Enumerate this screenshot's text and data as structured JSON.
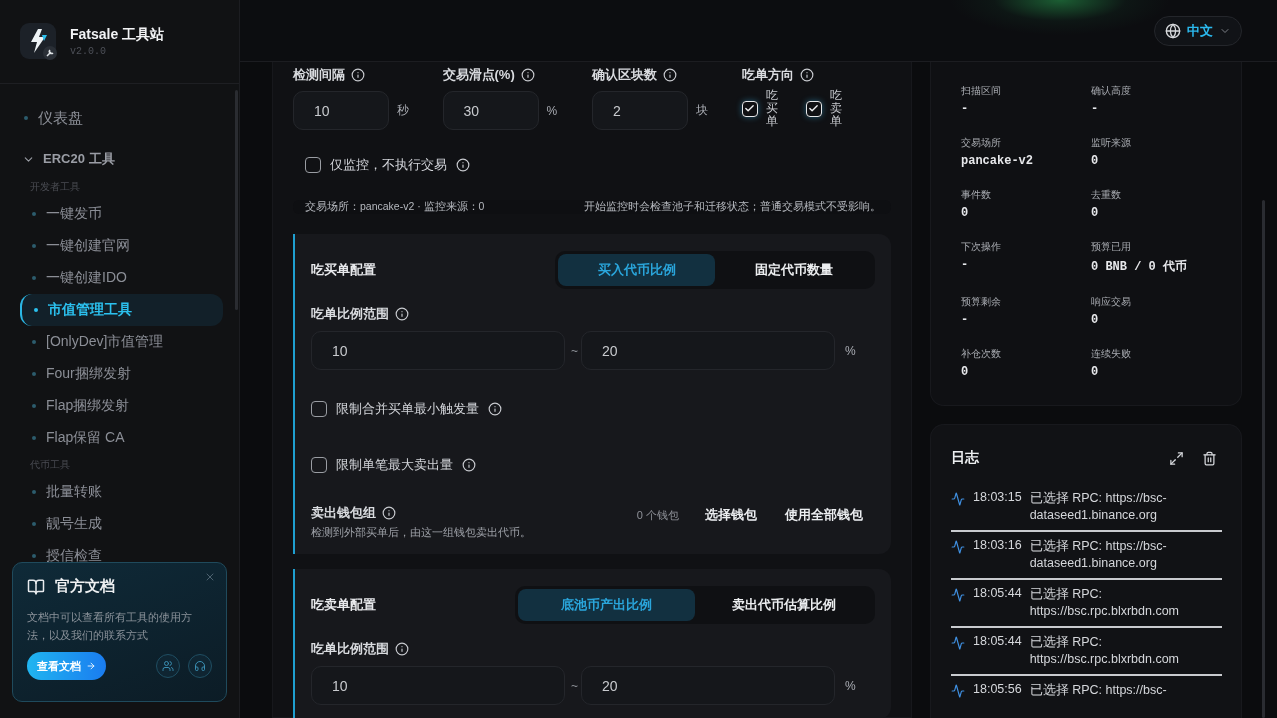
{
  "brand": {
    "title": "Fatsale 工具站",
    "version": "v2.0.0"
  },
  "nav": [
    {
      "kind": "item",
      "label": "仪表盘",
      "selected": false
    },
    {
      "kind": "group",
      "label": "ERC20 工具",
      "expanded": true,
      "sections": [
        {
          "title": "开发者工具",
          "items": [
            {
              "label": "一键发币",
              "selected": false
            },
            {
              "label": "一键创建官网",
              "selected": false
            },
            {
              "label": "一键创建IDO",
              "selected": false
            },
            {
              "label": "市值管理工具",
              "selected": true
            },
            {
              "label": "[OnlyDev]市值管理",
              "selected": false
            },
            {
              "label": "Four捆绑发射",
              "selected": false
            },
            {
              "label": "Flap捆绑发射",
              "selected": false
            },
            {
              "label": "Flap保留 CA",
              "selected": false
            }
          ]
        },
        {
          "title": "代币工具",
          "items": [
            {
              "label": "批量转账",
              "selected": false
            },
            {
              "label": "靓号生成",
              "selected": false
            },
            {
              "label": "授信检查",
              "selected": false
            }
          ]
        }
      ]
    }
  ],
  "docs_card": {
    "title": "官方文档",
    "text": "文档中可以查看所有工具的使用方法，以及我们的联系方式",
    "button": "查看文档"
  },
  "language": {
    "label": "中文"
  },
  "settings": {
    "fields": [
      {
        "label": "检测间隔",
        "value": "10",
        "unit": "秒"
      },
      {
        "label": "交易滑点(%)",
        "value": "30",
        "unit": "%"
      },
      {
        "label": "确认区块数",
        "value": "2",
        "unit": "块"
      }
    ],
    "direction": {
      "label": "吃单方向",
      "options": [
        {
          "label": "吃买单",
          "checked": true
        },
        {
          "label": "吃卖单",
          "checked": true
        }
      ]
    },
    "monitor_only": {
      "label": "仅监控，不执行交易",
      "checked": false
    },
    "info_left": "交易场所：pancake-v2 · 监控来源：0",
    "info_right": "开始监控时会检查池子和迁移状态；普通交易模式不受影响。"
  },
  "buy_config": {
    "title": "吃买单配置",
    "tabs": [
      {
        "label": "买入代币比例",
        "selected": true
      },
      {
        "label": "固定代币数量",
        "selected": false
      }
    ],
    "range": {
      "label": "吃单比例范围",
      "min": "10",
      "max": "20",
      "separator": "~",
      "unit": "%"
    },
    "options": [
      {
        "label": "限制合并买单最小触发量",
        "checked": false
      },
      {
        "label": "限制单笔最大卖出量",
        "checked": false
      }
    ],
    "wallet": {
      "label": "卖出钱包组",
      "description": "检测到外部买单后，由这一组钱包卖出代币。",
      "count": "0 个钱包",
      "buttons": [
        "选择钱包",
        "使用全部钱包"
      ]
    }
  },
  "sell_config": {
    "title": "吃卖单配置",
    "tabs": [
      {
        "label": "底池币产出比例",
        "selected": true
      },
      {
        "label": "卖出代币估算比例",
        "selected": false
      }
    ],
    "range": {
      "label": "吃单比例范围",
      "min": "10",
      "max": "20",
      "separator": "~",
      "unit": "%"
    }
  },
  "stats": [
    {
      "label": "扫描区间",
      "value": "-"
    },
    {
      "label": "确认高度",
      "value": "-"
    },
    {
      "label": "交易场所",
      "value": "pancake-v2"
    },
    {
      "label": "监听来源",
      "value": "0"
    },
    {
      "label": "事件数",
      "value": "0"
    },
    {
      "label": "去重数",
      "value": "0"
    },
    {
      "label": "下次操作",
      "value": "-"
    },
    {
      "label": "预算已用",
      "value": "0 BNB / 0 代币"
    },
    {
      "label": "预算剩余",
      "value": "-"
    },
    {
      "label": "响应交易",
      "value": "0"
    },
    {
      "label": "补仓次数",
      "value": "0"
    },
    {
      "label": "连续失败",
      "value": "0"
    }
  ],
  "log": {
    "title": "日志",
    "entries": [
      {
        "time": "18:03:15",
        "message": "已选择 RPC: https://bsc-dataseed1.binance.org"
      },
      {
        "time": "18:03:16",
        "message": "已选择 RPC: https://bsc-dataseed1.binance.org"
      },
      {
        "time": "18:05:44",
        "message": "已选择 RPC: https://bsc.rpc.blxrbdn.com"
      },
      {
        "time": "18:05:44",
        "message": "已选择 RPC: https://bsc.rpc.blxrbdn.com"
      },
      {
        "time": "18:05:56",
        "message": "已选择 RPC: https://bsc-"
      }
    ]
  }
}
